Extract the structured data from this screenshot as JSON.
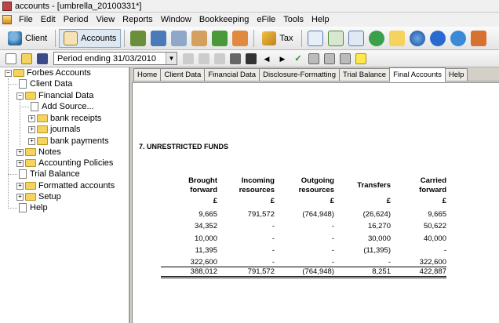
{
  "window": {
    "title": "accounts - [umbrella_20100331*]"
  },
  "menu": [
    {
      "label": "File"
    },
    {
      "label": "Edit"
    },
    {
      "label": "Period"
    },
    {
      "label": "View"
    },
    {
      "label": "Reports"
    },
    {
      "label": "Window"
    },
    {
      "label": "Bookkeeping"
    },
    {
      "label": "eFile"
    },
    {
      "label": "Tools"
    },
    {
      "label": "Help"
    }
  ],
  "toolbar": {
    "client_label": "Client",
    "accounts_label": "Accounts",
    "tax_label": "Tax"
  },
  "period": {
    "selected": "Period ending 31/03/2010"
  },
  "tree": {
    "root": "Forbes Accounts",
    "items": [
      {
        "label": "Client Data"
      },
      {
        "label": "Financial Data"
      },
      {
        "label": "Add Source..."
      },
      {
        "label": "bank receipts"
      },
      {
        "label": "journals"
      },
      {
        "label": "bank payments"
      },
      {
        "label": "Notes"
      },
      {
        "label": "Accounting Policies"
      },
      {
        "label": "Trial Balance"
      },
      {
        "label": "Formatted accounts"
      },
      {
        "label": "Setup"
      },
      {
        "label": "Help"
      }
    ]
  },
  "tabs": [
    {
      "label": "Home"
    },
    {
      "label": "Client Data"
    },
    {
      "label": "Financial Data"
    },
    {
      "label": "Disclosure-Formatting"
    },
    {
      "label": "Trial Balance"
    },
    {
      "label": "Final Accounts"
    },
    {
      "label": "Help"
    }
  ],
  "note": {
    "title": "7. UNRESTRICTED FUNDS",
    "headers": [
      [
        "Brought",
        "forward"
      ],
      [
        "Incoming",
        "resources"
      ],
      [
        "Outgoing",
        "resources"
      ],
      [
        "Transfers",
        ""
      ],
      [
        "Carried",
        "forward"
      ]
    ],
    "currency": [
      "£",
      "£",
      "£",
      "£",
      "£"
    ],
    "rows": [
      [
        "9,665",
        "791,572",
        "(764,948)",
        "(26,624)",
        "9,665"
      ],
      [
        "34,352",
        "-",
        "-",
        "16,270",
        "50,622"
      ],
      [
        "10,000",
        "-",
        "-",
        "30,000",
        "40,000"
      ],
      [
        "11,395",
        "-",
        "-",
        "(11,395)",
        "-"
      ],
      [
        "322,600",
        "-",
        "-",
        "-",
        "322,600"
      ]
    ],
    "totals": [
      "388,012",
      "791,572",
      "(764,948)",
      "8,251",
      "422,887"
    ]
  }
}
